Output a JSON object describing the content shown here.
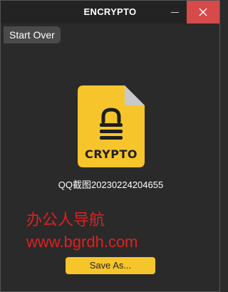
{
  "window": {
    "title": "ENCRYPTO"
  },
  "toolbar": {
    "start_over_label": "Start Over"
  },
  "file": {
    "icon": "encrypted-file-icon",
    "badge_text": "CRYPTO",
    "name": "QQ截图20230224204655"
  },
  "watermark": {
    "line1": "办公人导航",
    "line2": "www.bgrdh.com"
  },
  "actions": {
    "save_as_label": "Save As..."
  },
  "colors": {
    "background": "#2a2a2a",
    "accent_yellow": "#f6c52c",
    "close_red": "#d64a4a",
    "watermark_red": "#e02020"
  }
}
